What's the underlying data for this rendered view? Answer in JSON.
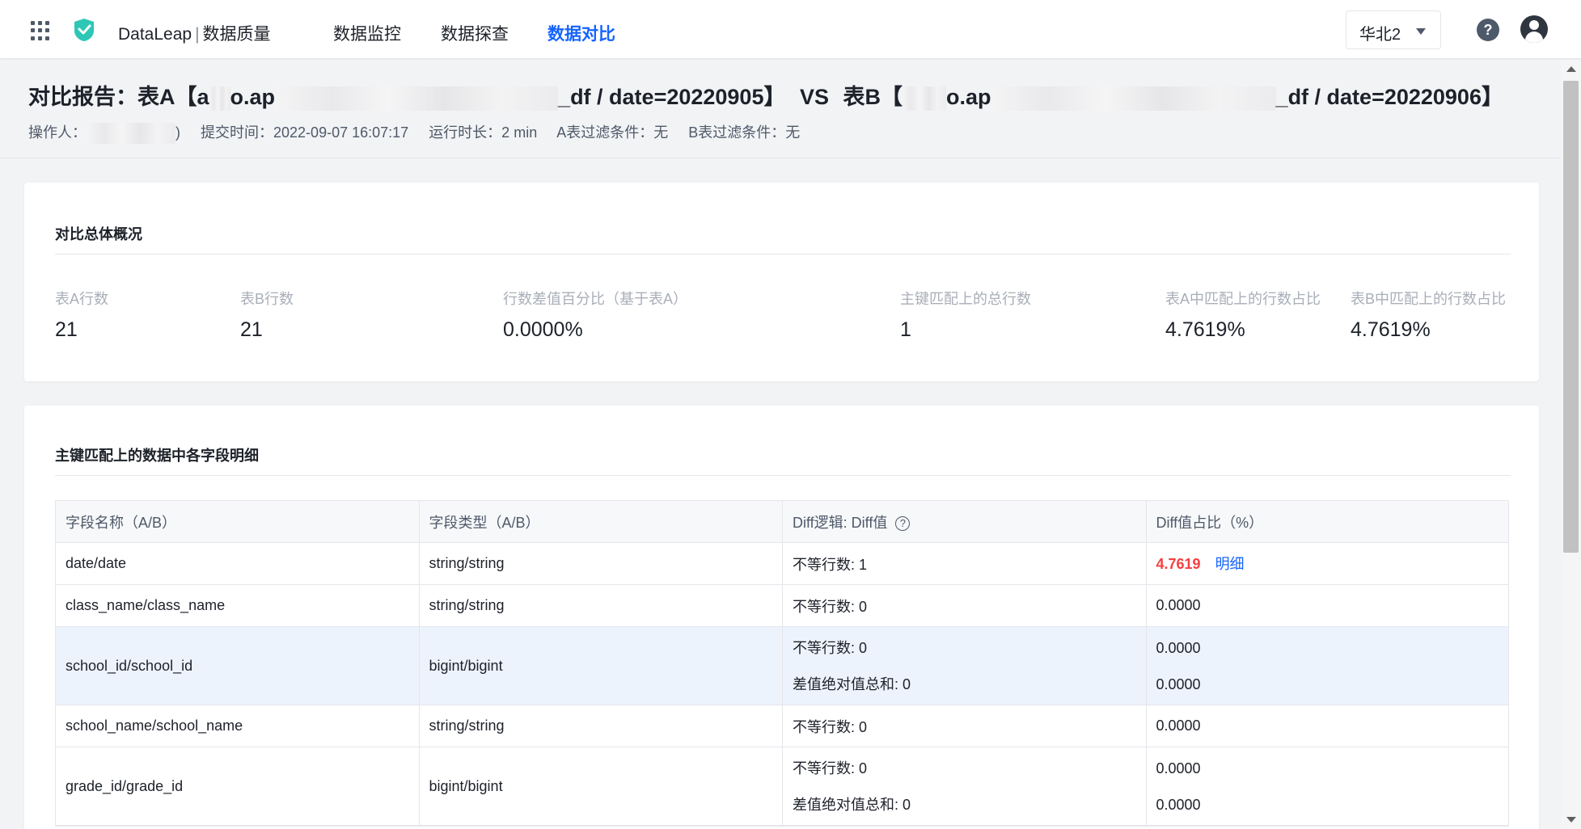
{
  "header": {
    "product": "DataLeap",
    "module": "数据质量",
    "nav": [
      "数据监控",
      "数据探查",
      "数据对比"
    ],
    "active_nav": "数据对比",
    "region": "华北2",
    "icons": [
      "grid-icon",
      "dataleap-logo",
      "help-icon",
      "avatar-icon"
    ]
  },
  "report": {
    "title_prefix": "对比报告：表A【",
    "table_a_visible_start": "a",
    "table_a_visible_mid": "o.ap",
    "table_a_visible_end": "_df / date=20220905】",
    "vs": "VS",
    "table_b_prefix": "表B【",
    "table_b_visible_mid": "o.ap",
    "table_b_visible_end": "_df / date=20220906】",
    "operator_label": "操作人：",
    "operator_suffix": ")",
    "submit_time": "提交时间：2022-09-07 16:07:17",
    "duration": "运行时长：2 min",
    "filter_a": "A表过滤条件：无",
    "filter_b": "B表过滤条件：无"
  },
  "overview": {
    "title": "对比总体概况",
    "stats": [
      {
        "label": "表A行数",
        "value": "21"
      },
      {
        "label": "表B行数",
        "value": "21"
      },
      {
        "label": "行数差值百分比（基于表A）",
        "value": "0.0000%"
      },
      {
        "label": "主键匹配上的总行数",
        "value": "1"
      },
      {
        "label": "表A中匹配上的行数占比",
        "value": "4.7619%"
      },
      {
        "label": "表B中匹配上的行数占比",
        "value": "4.7619%"
      }
    ]
  },
  "details": {
    "title": "主键匹配上的数据中各字段明细",
    "columns": [
      "字段名称（A/B）",
      "字段类型（A/B）",
      "Diff逻辑: Diff值",
      "Diff值占比（%）"
    ],
    "rows": [
      {
        "name": "date/date",
        "type": "string/string",
        "logic": [
          "不等行数: 1"
        ],
        "ratio": [
          "4.7619"
        ],
        "link": "明细"
      },
      {
        "name": "class_name/class_name",
        "type": "string/string",
        "logic": [
          "不等行数: 0"
        ],
        "ratio": [
          "0.0000"
        ]
      },
      {
        "name": "school_id/school_id",
        "type": "bigint/bigint",
        "logic": [
          "不等行数: 0",
          "差值绝对值总和: 0"
        ],
        "ratio": [
          "0.0000",
          "0.0000"
        ]
      },
      {
        "name": "school_name/school_name",
        "type": "string/string",
        "logic": [
          "不等行数: 0"
        ],
        "ratio": [
          "0.0000"
        ]
      },
      {
        "name": "grade_id/grade_id",
        "type": "bigint/bigint",
        "logic": [
          "不等行数: 0",
          "差值绝对值总和: 0"
        ],
        "ratio": [
          "0.0000",
          "0.0000"
        ]
      }
    ]
  },
  "colors": {
    "accent": "#1664ff",
    "danger": "#f53f3f",
    "highlight_row": "#edf3fc"
  }
}
